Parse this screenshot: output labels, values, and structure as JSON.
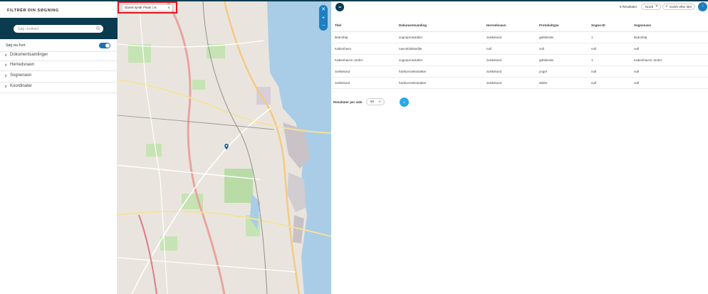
{
  "sidebar": {
    "title": "FILTRÉR DIN SØGNING",
    "search_placeholder": "Søg i indhold",
    "toggle_label": "Søg via Kort",
    "toggle_on": true,
    "accordions": [
      {
        "label": "Dokumentsamlinger"
      },
      {
        "label": "Herredsnavn"
      },
      {
        "label": "Sognenavn"
      },
      {
        "label": "Koordinater"
      }
    ]
  },
  "map": {
    "layer_select": "Dansk kjeldr Plads | st.",
    "tools": [
      "close-icon",
      "zoom-in-icon",
      "zoom-out-icon"
    ],
    "accent": "#1e7fc0",
    "highlight_color": "#e0141c"
  },
  "results": {
    "count_label": "5 Resultater",
    "chip_label": "Nordt",
    "sort_label": "Sortér efter titel",
    "columns": [
      "Titel",
      "Dokumentsamling",
      "Herredsnavn",
      "Protokoltype",
      "Sogne-ID",
      "Sognenavn"
    ],
    "rows": [
      [
        "Brønshøj",
        "sogneprotokoller",
        "Sokkelund",
        "gældende",
        "1",
        "Brønshøj"
      ],
      [
        "København",
        "navneblokkedler",
        "null",
        "null",
        "null",
        "null"
      ],
      [
        "Københavns Jorder",
        "sogneprotokoller",
        "Sokkelund",
        "gældende",
        "1",
        "Københavns Jorder"
      ],
      [
        "Sokkelund",
        "hartkornsekstrakter",
        "Sokkelund",
        "yngre",
        "null",
        "null"
      ],
      [
        "Sokkelund",
        "hartkornsekstrakter",
        "Sokkelund",
        "ældre",
        "null",
        "null"
      ]
    ],
    "per_page_label": "Resultater per side",
    "per_page_value": "50",
    "current_page": "1"
  }
}
